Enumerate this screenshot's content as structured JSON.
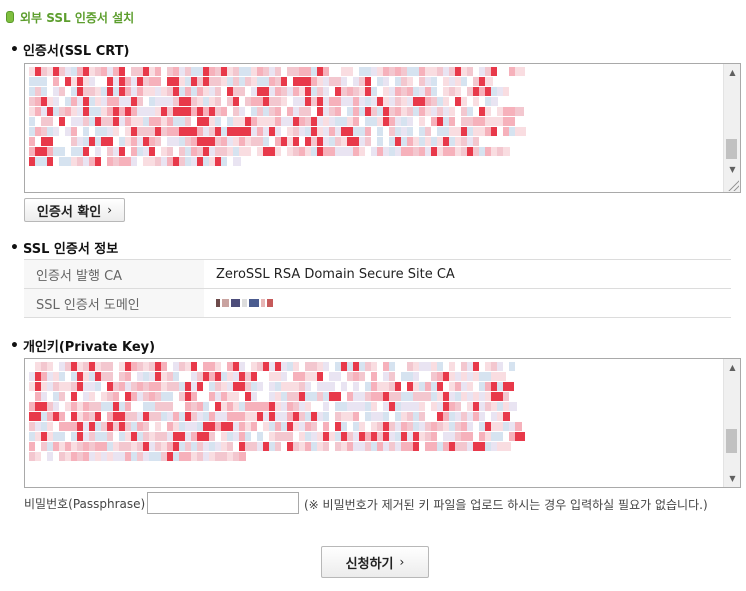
{
  "page": {
    "title": "외부 SSL 인증서 설치"
  },
  "certificate": {
    "heading": "인증서(SSL CRT)",
    "check_button": "인증서 확인"
  },
  "cert_info": {
    "heading": "SSL 인증서 정보",
    "rows": [
      {
        "label": "인증서 발행 CA",
        "value": "ZeroSSL RSA Domain Secure Site CA"
      },
      {
        "label": "SSL 인증서 도메인",
        "value": ""
      }
    ]
  },
  "private_key": {
    "heading": "개인키(Private Key)"
  },
  "passphrase": {
    "label": "비밀번호(Passphrase)",
    "value": "",
    "note": "(※ 비밀번호가 제거된 키 파일을 업로드 하시는 경우 입력하실 필요가 없습니다.)"
  },
  "submit_button": "신청하기",
  "icons": {
    "title": "green-badge-icon",
    "button_chevron": "chevron-right-icon",
    "scroll_up": "scroll-up-arrow-icon",
    "scroll_down": "scroll-down-arrow-icon",
    "resize": "resize-grip-icon"
  },
  "colors": {
    "title_green": "#5d9e2e",
    "redacted_red": "#e8394a",
    "redacted_pink": "#f6b1bb"
  }
}
